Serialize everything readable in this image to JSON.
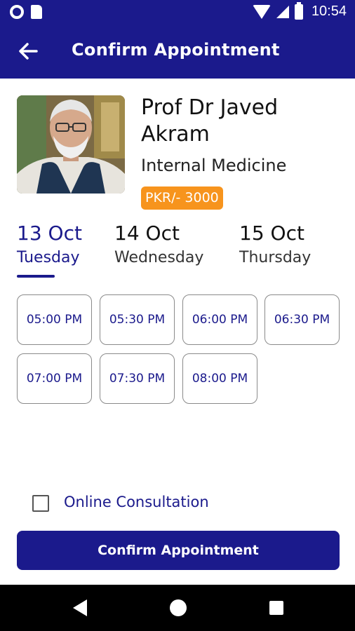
{
  "status_bar": {
    "time": "10:54"
  },
  "app_bar": {
    "title": "Confirm Appointment"
  },
  "doctor": {
    "name": "Prof Dr Javed Akram",
    "specialty": "Internal Medicine",
    "fee": "PKR/- 3000"
  },
  "dates": [
    {
      "date": "13 Oct",
      "day": "Tuesday",
      "selected": true
    },
    {
      "date": "14 Oct",
      "day": "Wednesday",
      "selected": false
    },
    {
      "date": "15 Oct",
      "day": "Thursday",
      "selected": false
    }
  ],
  "time_slots": [
    "05:00 PM",
    "05:30 PM",
    "06:00 PM",
    "06:30 PM",
    "07:00 PM",
    "07:30 PM",
    "08:00 PM"
  ],
  "online_consultation": {
    "label": "Online Consultation",
    "checked": false
  },
  "confirm_button": {
    "label": "Confirm Appointment"
  },
  "colors": {
    "primary": "#1b1a8c",
    "fee_badge": "#f7941d"
  },
  "icons": {
    "back": "arrow-left-icon",
    "nav_back": "triangle-back-icon",
    "nav_home": "circle-home-icon",
    "nav_recent": "square-recents-icon"
  }
}
